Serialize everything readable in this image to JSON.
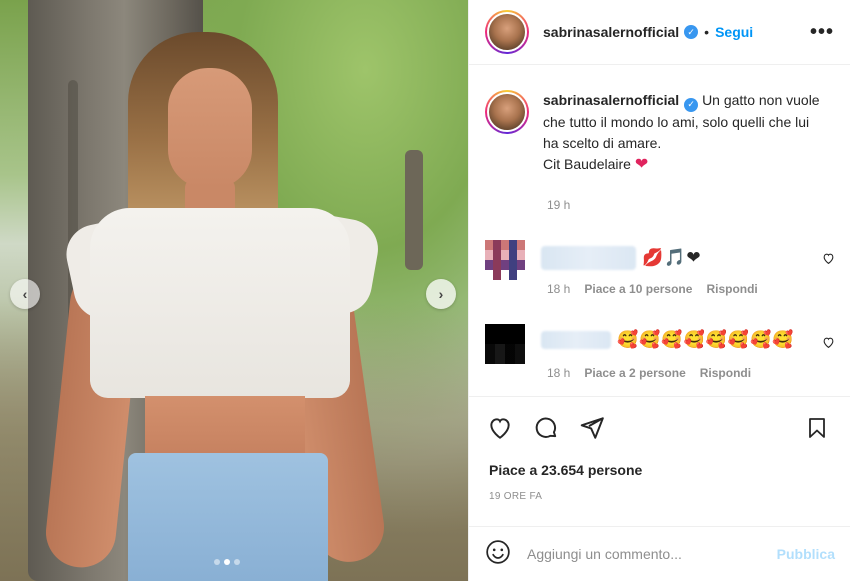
{
  "post": {
    "username": "sabrinasalernofficial",
    "separator": "•",
    "follow_label": "Segui",
    "more_label": "•••"
  },
  "caption": {
    "username": "sabrinasalernofficial",
    "text": "Un gatto non vuole che tutto il mondo lo ami, solo quelli che lui ha scelto di amare.",
    "cit": "Cit Baudelaire",
    "emoji": "❤",
    "time": "19 h"
  },
  "comments": [
    {
      "text": "💋🎵❤",
      "time": "18 h",
      "likes": "Piace a 10 persone",
      "reply": "Rispondi"
    },
    {
      "text": "🥰🥰🥰🥰🥰🥰🥰🥰",
      "time": "18 h",
      "likes": "Piace a 2 persone",
      "reply": "Rispondi"
    }
  ],
  "carousel": {
    "prev": "‹",
    "next": "›",
    "total_dots": 3,
    "active_dot": 1
  },
  "actions": {
    "likes": "Piace a 23.654 persone",
    "time_ago": "19 ORE FA"
  },
  "add_comment": {
    "placeholder": "Aggiungi un commento...",
    "publish_label": "Pubblica"
  },
  "colors": {
    "link": "#0095f6",
    "verified": "#3897f0",
    "publish_disabled": "#b2dffc"
  },
  "icons": [
    "heart-icon",
    "comment-icon",
    "share-icon",
    "bookmark-icon",
    "emoji-icon",
    "verified-icon",
    "more-icon",
    "chevron-left-icon",
    "chevron-right-icon"
  ]
}
